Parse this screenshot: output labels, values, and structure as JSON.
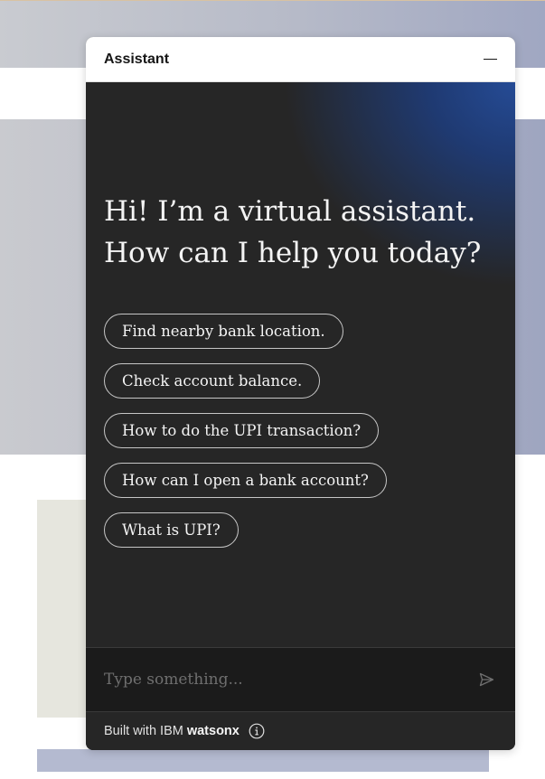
{
  "widget": {
    "title": "Assistant",
    "greeting_line1": "Hi! I’m a virtual assistant.",
    "greeting_line2": "How can I help you today?",
    "options": [
      "Find nearby bank location.",
      "Check account balance.",
      "How to do the UPI transaction?",
      "How can I open a bank account?",
      "What is UPI?"
    ],
    "input_placeholder": "Type something...",
    "footer_prefix": "Built with IBM",
    "footer_brand": "watsonx"
  },
  "icons": {
    "minimize": "minimize-icon",
    "send": "send-icon",
    "info": "info-icon"
  },
  "colors": {
    "header_bg": "#ffffff",
    "body_bg": "#262626",
    "accent_glow": "#254b95",
    "input_bg": "#1b1b1b",
    "text_light": "#f4f4f4",
    "placeholder": "#6f6f6f"
  }
}
